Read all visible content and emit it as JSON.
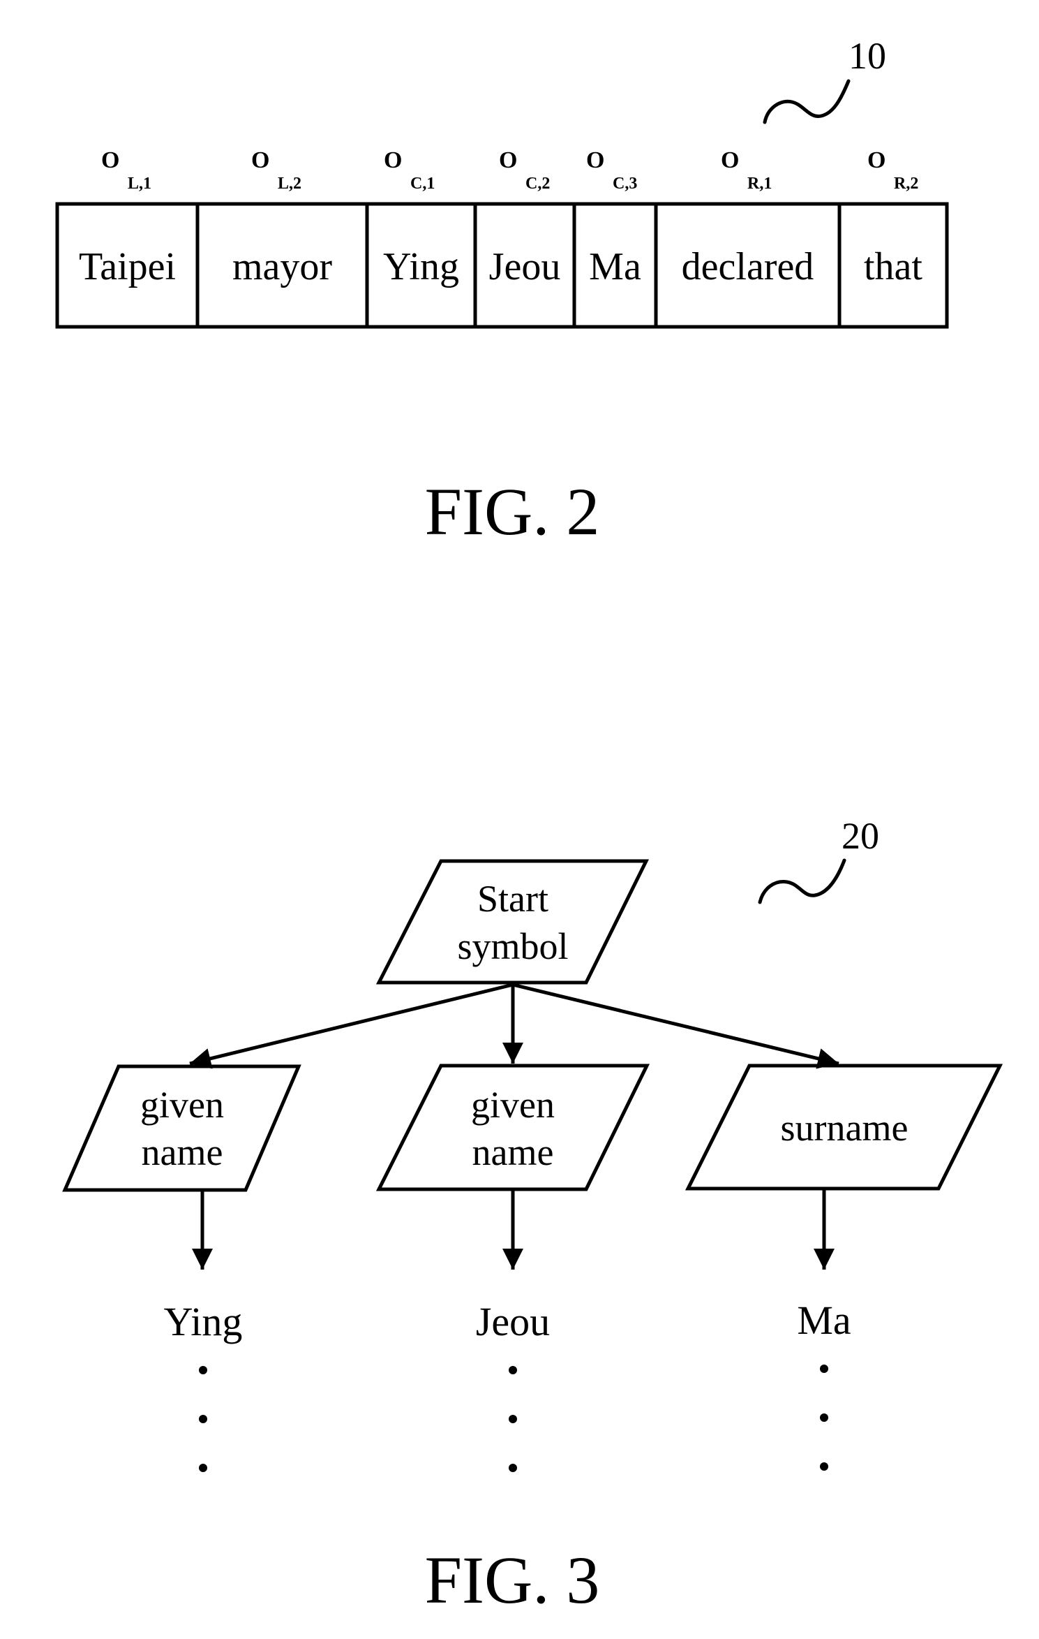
{
  "figures": [
    {
      "id": "fig2",
      "label": "FIG. 2",
      "reference_numeral": "10",
      "sequence": [
        {
          "word": "Taipei",
          "obs_main": "O",
          "obs_sub": "L,1"
        },
        {
          "word": "mayor",
          "obs_main": "O",
          "obs_sub": "L,2"
        },
        {
          "word": "Ying",
          "obs_main": "O",
          "obs_sub": "C,1"
        },
        {
          "word": "Jeou",
          "obs_main": "O",
          "obs_sub": "C,2"
        },
        {
          "word": "Ma",
          "obs_main": "O",
          "obs_sub": "C,3"
        },
        {
          "word": "declared",
          "obs_main": "O",
          "obs_sub": "R,1"
        },
        {
          "word": "that",
          "obs_main": "O",
          "obs_sub": "R,2"
        }
      ]
    },
    {
      "id": "fig3",
      "label": "FIG. 3",
      "reference_numeral": "20",
      "root": {
        "lines": [
          "Start",
          "symbol"
        ]
      },
      "children": [
        {
          "lines": [
            "given",
            "name"
          ],
          "leaf": "Ying",
          "continuation": "⋮"
        },
        {
          "lines": [
            "given",
            "name"
          ],
          "leaf": "Jeou",
          "continuation": "⋮"
        },
        {
          "lines": [
            "surname"
          ],
          "leaf": "Ma",
          "continuation": "⋮"
        }
      ]
    }
  ]
}
